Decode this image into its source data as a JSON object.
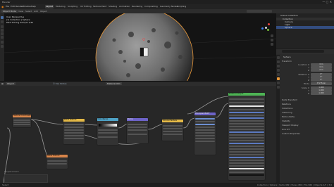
{
  "app": {
    "title": "Blender",
    "menus": [
      "File",
      "Edit",
      "Render",
      "Window",
      "Help"
    ],
    "workspaces": [
      "Layout",
      "Modeling",
      "Sculpting",
      "UV Editing",
      "Texture Paint",
      "Shading",
      "Animation",
      "Rendering",
      "Compositing",
      "Geometry Nodes",
      "Scripting"
    ],
    "active_workspace": "Layout"
  },
  "viewport": {
    "mode": "Object Mode",
    "info_lines": [
      "User Perspective",
      "(1) Collection | Sphere",
      "Path Tracing Sample 1/32"
    ]
  },
  "node_editor": {
    "object": "Object",
    "slot": "Material.001",
    "nodes": [
      {
        "title": "Texture Coordinate"
      },
      {
        "title": "Noise Texture"
      },
      {
        "title": "ColorRamp"
      },
      {
        "title": "Bump"
      },
      {
        "title": "Voronoi Texture"
      },
      {
        "title": "Principled BSDF"
      },
      {
        "title": "Material Output"
      },
      {
        "title": "Noise Texture"
      }
    ],
    "frame_label": "Displacement"
  },
  "outliner": {
    "title": "Scene Collection",
    "items": [
      "Collection",
      "Camera",
      "Light",
      "Sphere"
    ]
  },
  "properties": {
    "search_placeholder": "",
    "object_name": "Sphere",
    "sections": [
      "Transform",
      "Delta Transform",
      "Relations",
      "Collections",
      "Instancing",
      "Motion Paths",
      "Visibility",
      "Viewport Display",
      "Line Art",
      "Custom Properties"
    ],
    "location_label": "Location X",
    "rotation_label": "Rotation X",
    "scale_label": "Scale X",
    "mode_label": "Mode",
    "mode_value": "XYZ Euler",
    "x_label": "X",
    "y_label": "Y",
    "z_label": "Z",
    "zero": "0 m",
    "deg": "0°",
    "one": "1.000"
  },
  "status": {
    "left": "Select",
    "right": "Collection | Sphere | Verts:482 | Faces:480 | Tris:960 | Objects:1/3 | 3.0"
  },
  "colors": {
    "accent": "#4a6fa5",
    "node_input": "#d8854a",
    "node_texture": "#e4b947",
    "node_converter": "#4fa3c7",
    "node_vector": "#6d63c7",
    "node_shader": "#4eb555",
    "node_output": "#b83a3a"
  }
}
